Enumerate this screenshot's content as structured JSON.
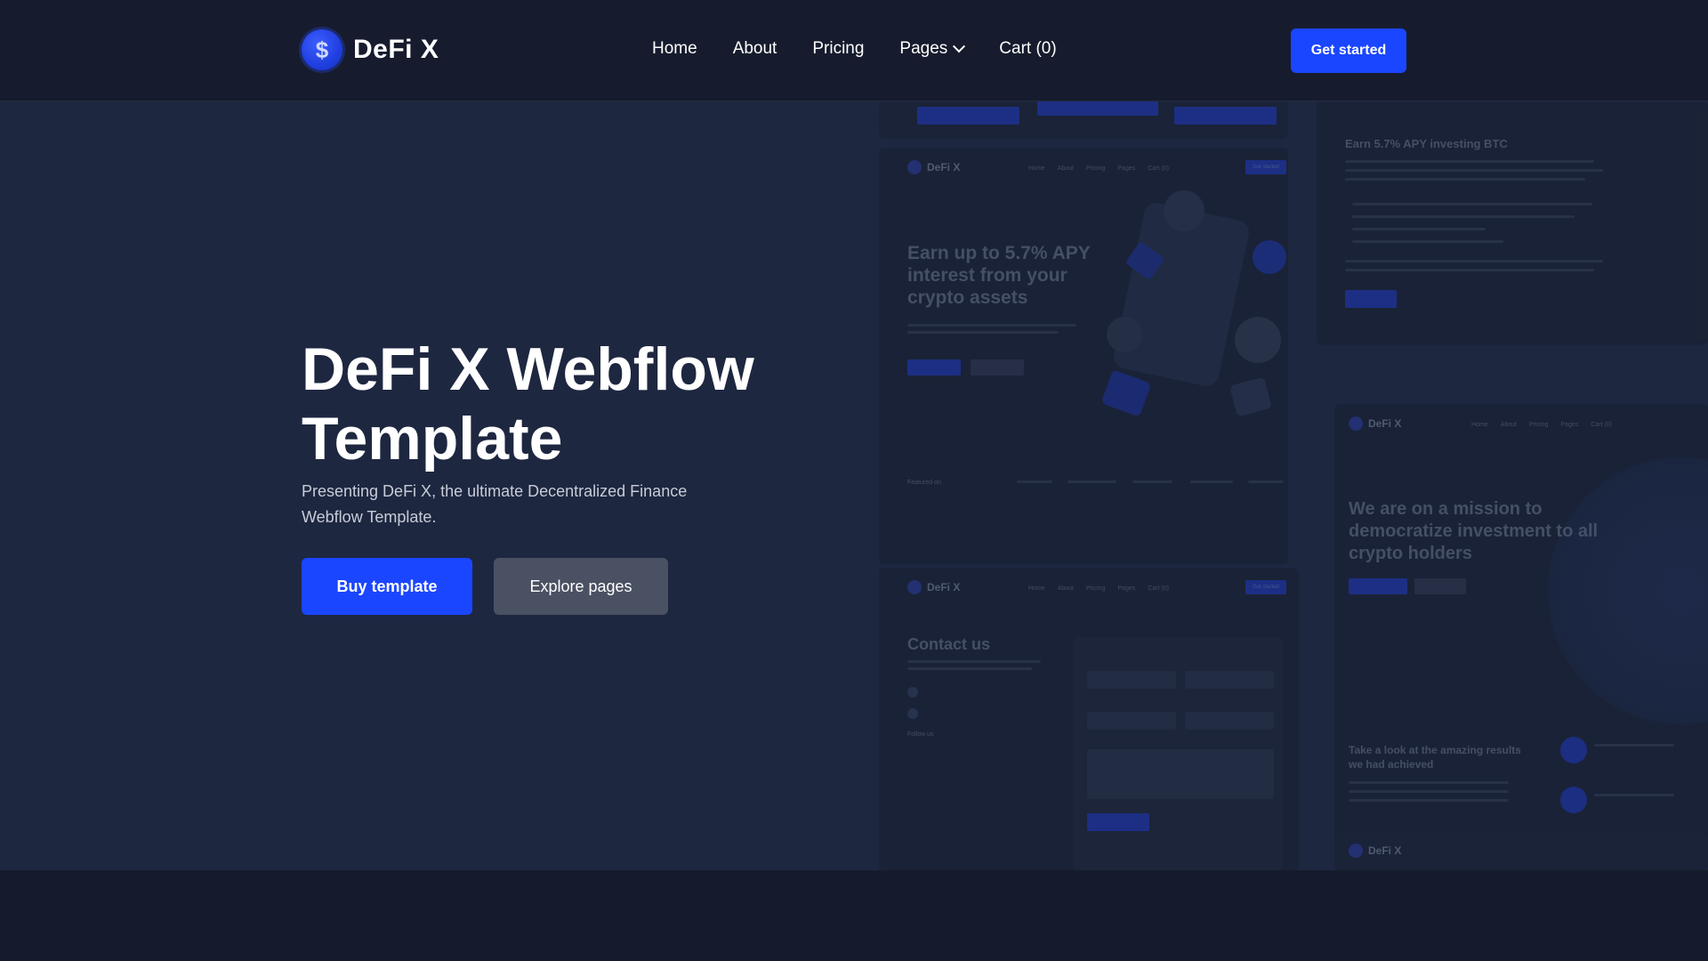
{
  "header": {
    "brand": "DeFi X",
    "logo_glyph": "$",
    "nav": [
      {
        "label": "Home"
      },
      {
        "label": "About"
      },
      {
        "label": "Pricing"
      },
      {
        "label": "Pages"
      },
      {
        "label": "Cart (0)"
      }
    ],
    "cta": "Get started"
  },
  "hero": {
    "title": "DeFi X Webflow Template",
    "subtitle": "Presenting DeFi X, the ultimate Decentralized Finance Webflow Template.",
    "primary_button": "Buy template",
    "secondary_button": "Explore pages"
  },
  "previews": {
    "home": {
      "brand": "DeFi X",
      "links": [
        "Home",
        "About",
        "Pricing",
        "Pages",
        "Cart (0)"
      ],
      "button": "Get started",
      "heading": "Earn up to 5.7% APY interest from your crypto assets",
      "featured_label": "Featured on"
    },
    "blog": {
      "heading": "Earn 5.7% APY investing BTC"
    },
    "about": {
      "brand": "DeFi X",
      "links": [
        "Home",
        "About",
        "Pricing",
        "Pages",
        "Cart (0)"
      ],
      "heading": "We are on a mission to democratize investment to all crypto holders",
      "results_heading": "Take a look at the amazing results we had achieved"
    },
    "contact": {
      "brand": "DeFi X",
      "links": [
        "Home",
        "About",
        "Pricing",
        "Pages",
        "Cart (0)"
      ],
      "button": "Get started",
      "heading": "Contact us",
      "follow_label": "Follow us"
    },
    "footer_nav": {
      "brand": "DeFi X"
    }
  },
  "colors": {
    "accent": "#1b46ff",
    "header_bg": "#161c2d",
    "hero_bg": "#1e2740",
    "secondary_button": "#4a5163"
  }
}
